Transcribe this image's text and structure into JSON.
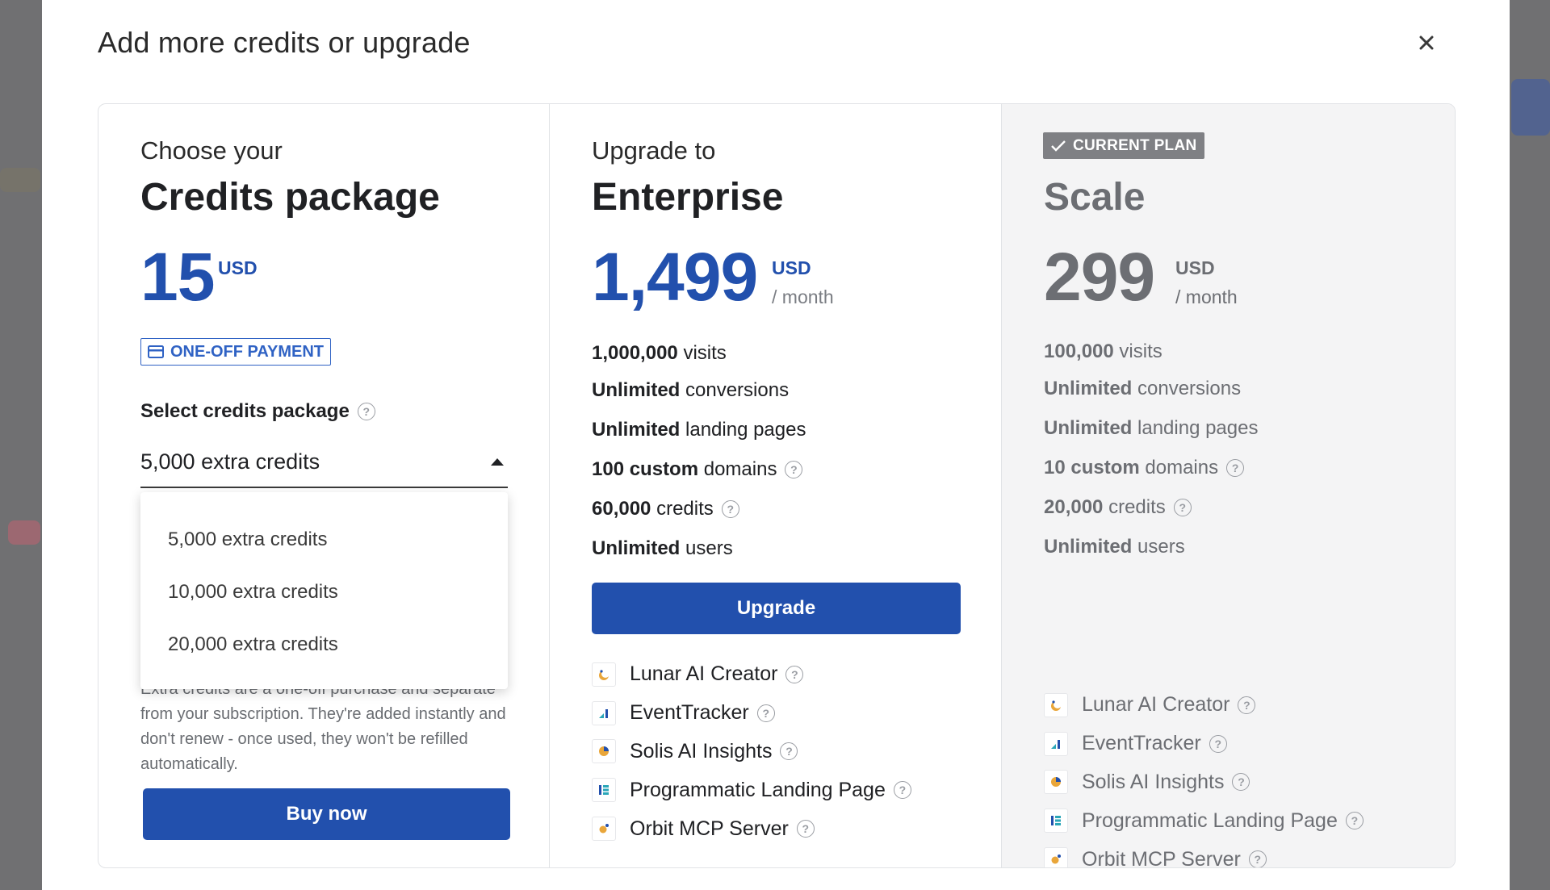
{
  "modal": {
    "title": "Add more credits or upgrade"
  },
  "credits": {
    "pre_title": "Choose your",
    "title": "Credits package",
    "price": "15",
    "currency": "USD",
    "badge": "ONE-OFF PAYMENT",
    "select_label": "Select credits package",
    "selected": "5,000 extra credits",
    "options": [
      "5,000 extra credits",
      "10,000 extra credits",
      "20,000 extra credits"
    ],
    "description": "Extra credits are a one-off purchase and separate from your subscription. They're added instantly and don't renew - once used, they won't be refilled automatically.",
    "buy_label": "Buy now"
  },
  "enterprise": {
    "pre_title": "Upgrade to",
    "title": "Enterprise",
    "price": "1,499",
    "currency": "USD",
    "period": "/ month",
    "features": [
      {
        "bold": "1,000,000",
        "rest": " visits",
        "help": false
      },
      {
        "bold": "Unlimited",
        "rest": " conversions",
        "help": false
      },
      {
        "bold": "Unlimited",
        "rest": " landing pages",
        "help": false
      },
      {
        "bold": "100 custom",
        "rest": " domains",
        "help": true
      },
      {
        "bold": "60,000",
        "rest": " credits",
        "help": true
      },
      {
        "bold": "Unlimited",
        "rest": " users",
        "help": false
      }
    ],
    "upgrade_label": "Upgrade",
    "addons": [
      "Lunar AI Creator",
      "EventTracker",
      "Solis AI Insights",
      "Programmatic Landing Page",
      "Orbit MCP Server"
    ]
  },
  "scale": {
    "badge": "CURRENT PLAN",
    "title": "Scale",
    "price": "299",
    "currency": "USD",
    "period": "/ month",
    "features": [
      {
        "bold": "100,000",
        "rest": " visits",
        "help": false
      },
      {
        "bold": "Unlimited",
        "rest": " conversions",
        "help": false
      },
      {
        "bold": "Unlimited",
        "rest": " landing pages",
        "help": false
      },
      {
        "bold": "10 custom",
        "rest": " domains",
        "help": true
      },
      {
        "bold": "20,000",
        "rest": " credits",
        "help": true
      },
      {
        "bold": "Unlimited",
        "rest": " users",
        "help": false
      }
    ],
    "addons": [
      "Lunar AI Creator",
      "EventTracker",
      "Solis AI Insights",
      "Programmatic Landing Page",
      "Orbit MCP Server"
    ]
  },
  "icons": {
    "close": "close-icon",
    "help": "question-circle-icon",
    "card": "credit-card-icon",
    "check": "check-icon",
    "addon_icons": [
      "lunar-ai-creator-icon",
      "eventtracker-icon",
      "solis-ai-insights-icon",
      "programmatic-landing-page-icon",
      "orbit-mcp-server-icon"
    ]
  },
  "colors": {
    "primary": "#2250ad",
    "muted": "#6c6e73",
    "current_plan_bg": "#f4f4f5",
    "badge_gray": "#7f8084"
  }
}
